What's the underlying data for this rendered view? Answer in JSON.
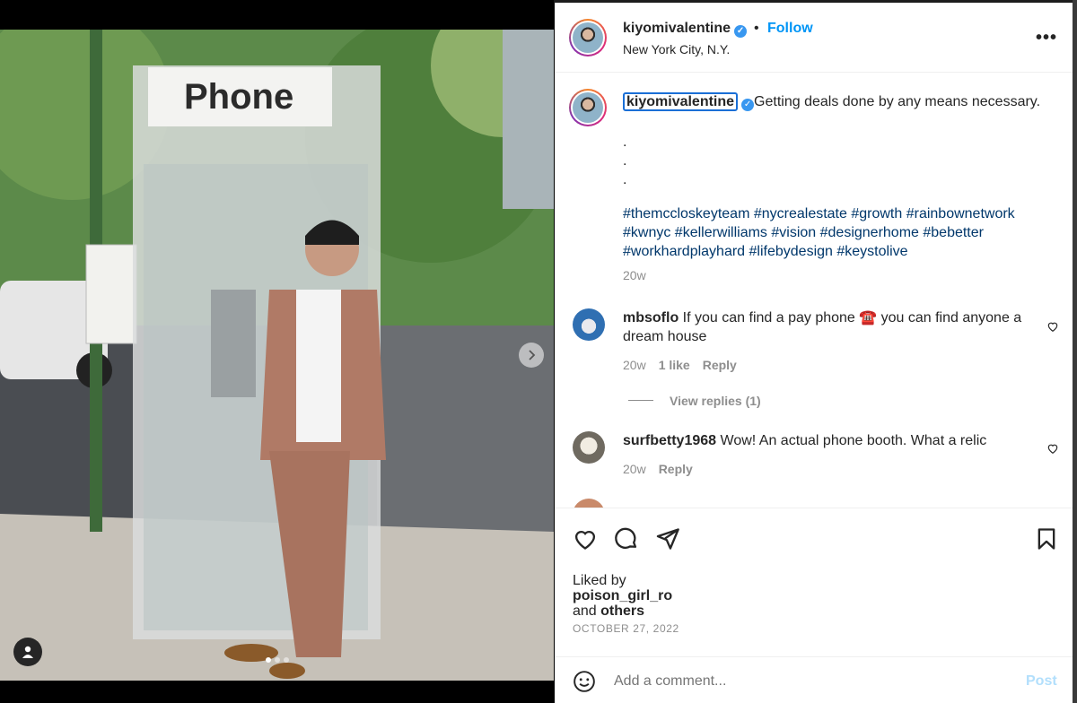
{
  "post": {
    "username": "kiyomivalentine",
    "follow_label": "Follow",
    "separator": "•",
    "location": "New York City, N.Y.",
    "more_label": "•••",
    "verified_mark": "✓"
  },
  "caption": {
    "username": "kiyomivalentine",
    "text": "Getting deals done by any means necessary.",
    "dot_lines": [
      ".",
      ".",
      "."
    ],
    "hashtags": "#themccloskeyteam #nycrealestate #growth #rainbownetwork #kwnyc #kellerwilliams #vision #designerhome #bebetter #workhardplayhard #lifebydesign #keystolive",
    "time": "20w"
  },
  "comments": [
    {
      "username": "mbsoflo",
      "text": "If you can find a pay phone ☎️ you can find anyone a dream house",
      "time": "20w",
      "likes": "1 like",
      "reply_label": "Reply",
      "view_replies": "View replies (1)"
    },
    {
      "username": "surfbetty1968",
      "text": "Wow! An actual phone booth. What a relic",
      "time": "20w",
      "reply_label": "Reply"
    }
  ],
  "likes": {
    "prefix": "Liked by",
    "user": "poison_girl_ro",
    "and": "and",
    "others": "others"
  },
  "date": "OCTOBER 27, 2022",
  "comment_box": {
    "placeholder": "Add a comment...",
    "post_label": "Post"
  },
  "photo": {
    "sign_text": "Phone",
    "slide_index": 0,
    "slide_count": 3
  },
  "icons": {
    "like": "heart-icon",
    "comment": "comment-icon",
    "share": "paper-plane-icon",
    "save": "bookmark-icon",
    "emoji": "emoji-icon",
    "next": "chevron-right-icon",
    "tag": "user-tag-icon"
  }
}
